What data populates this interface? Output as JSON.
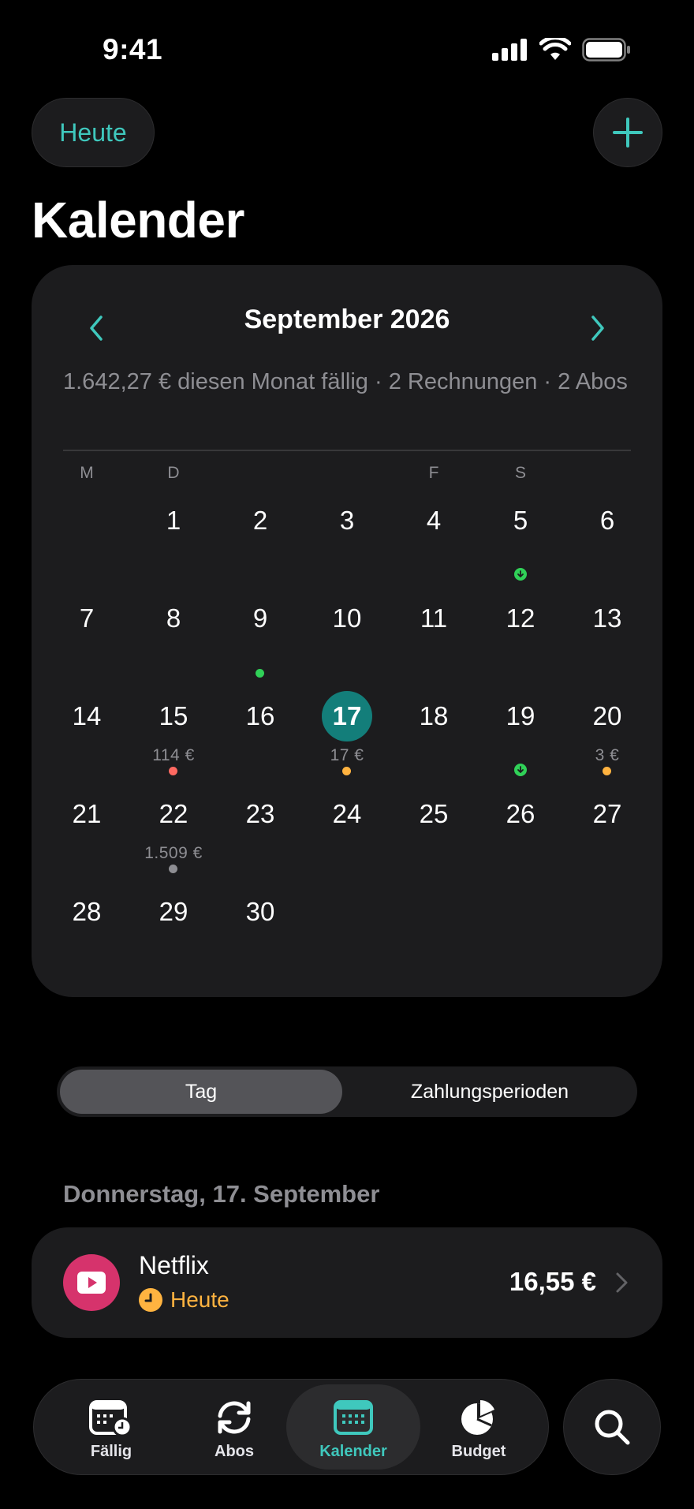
{
  "status_bar": {
    "time": "9:41"
  },
  "header": {
    "today_label": "Heute",
    "title": "Kalender"
  },
  "calendar": {
    "month_title": "September 2026",
    "summary": "1.642,27 € diesen Monat fällig · 2 Rechnungen · 2 Abos",
    "weekdays": [
      "M",
      "D",
      "",
      "",
      "F",
      "S",
      ""
    ],
    "days": [
      {
        "day": "1",
        "row": 0,
        "col": 1
      },
      {
        "day": "2",
        "row": 0,
        "col": 2
      },
      {
        "day": "3",
        "row": 0,
        "col": 3
      },
      {
        "day": "4",
        "row": 0,
        "col": 4
      },
      {
        "day": "5",
        "row": 0,
        "col": 5,
        "marker": "income"
      },
      {
        "day": "6",
        "row": 0,
        "col": 6
      },
      {
        "day": "7",
        "row": 1,
        "col": 0
      },
      {
        "day": "8",
        "row": 1,
        "col": 1
      },
      {
        "day": "9",
        "row": 1,
        "col": 2,
        "marker": "dot",
        "marker_color": "#30d158"
      },
      {
        "day": "10",
        "row": 1,
        "col": 3
      },
      {
        "day": "11",
        "row": 1,
        "col": 4
      },
      {
        "day": "12",
        "row": 1,
        "col": 5
      },
      {
        "day": "13",
        "row": 1,
        "col": 6
      },
      {
        "day": "14",
        "row": 2,
        "col": 0
      },
      {
        "day": "15",
        "row": 2,
        "col": 1,
        "amount": "114 €",
        "marker": "dot",
        "marker_color": "#ff6961"
      },
      {
        "day": "16",
        "row": 2,
        "col": 2
      },
      {
        "day": "17",
        "row": 2,
        "col": 3,
        "amount": "17 €",
        "marker": "dot",
        "marker_color": "#ffb340",
        "today": true
      },
      {
        "day": "18",
        "row": 2,
        "col": 4
      },
      {
        "day": "19",
        "row": 2,
        "col": 5,
        "marker": "income"
      },
      {
        "day": "20",
        "row": 2,
        "col": 6,
        "amount": "3 €",
        "marker": "dot",
        "marker_color": "#ffb340"
      },
      {
        "day": "21",
        "row": 3,
        "col": 0
      },
      {
        "day": "22",
        "row": 3,
        "col": 1,
        "amount": "1.509 €",
        "marker": "dot",
        "marker_color": "#8e8e93"
      },
      {
        "day": "23",
        "row": 3,
        "col": 2
      },
      {
        "day": "24",
        "row": 3,
        "col": 3
      },
      {
        "day": "25",
        "row": 3,
        "col": 4
      },
      {
        "day": "26",
        "row": 3,
        "col": 5
      },
      {
        "day": "27",
        "row": 3,
        "col": 6
      },
      {
        "day": "28",
        "row": 4,
        "col": 0
      },
      {
        "day": "29",
        "row": 4,
        "col": 1
      },
      {
        "day": "30",
        "row": 4,
        "col": 2
      }
    ]
  },
  "segmented": {
    "day_label": "Tag",
    "periods_label": "Zahlungsperioden",
    "selected": "Tag"
  },
  "selected_day": {
    "heading": "Donnerstag, 17. September",
    "items": [
      {
        "name": "Netflix",
        "status": "Heute",
        "amount": "16,55 €",
        "icon": "play-icon",
        "icon_color": "#d6336c"
      }
    ]
  },
  "tab_bar": {
    "tabs": [
      {
        "label": "Fällig",
        "icon": "calendar-clock-icon"
      },
      {
        "label": "Abos",
        "icon": "refresh-icon"
      },
      {
        "label": "Kalender",
        "icon": "calendar-icon",
        "active": true
      },
      {
        "label": "Budget",
        "icon": "pie-chart-icon"
      }
    ]
  },
  "colors": {
    "accent": "#3fc8bd",
    "today_fill": "#137e7a",
    "warning": "#ffb340"
  }
}
